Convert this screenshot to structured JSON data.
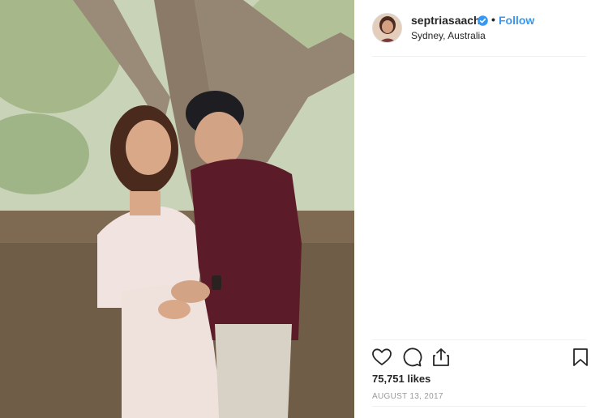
{
  "post": {
    "username": "septriasaacha",
    "follow_label": "Follow",
    "separator": "•",
    "location": "Sydney, Australia",
    "likes": "75,751 likes",
    "date": "AUGUST 13, 2017"
  },
  "icons": {
    "like": "heart-icon",
    "comment": "comment-icon",
    "share": "share-icon",
    "save": "bookmark-icon",
    "verified": "verified-badge-icon"
  },
  "colors": {
    "accent": "#3897f0",
    "text": "#262626",
    "muted": "#999999",
    "divider": "#efefef"
  }
}
